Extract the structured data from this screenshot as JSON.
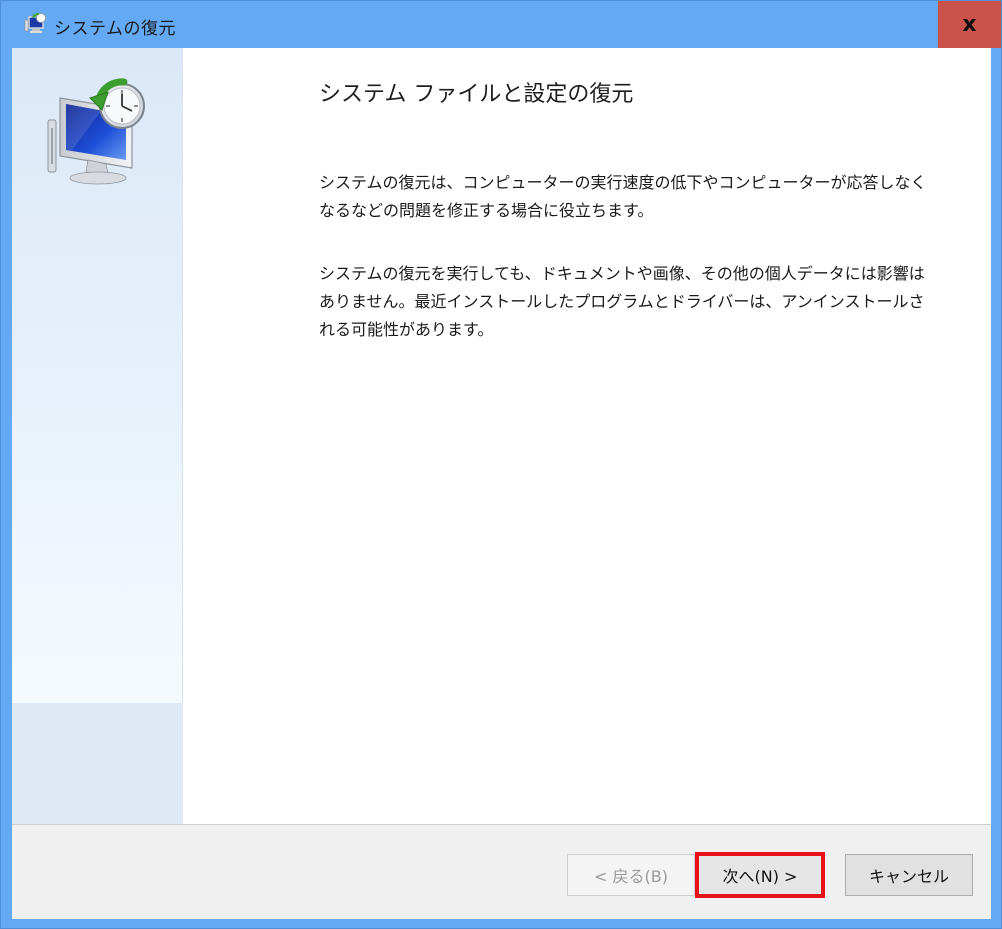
{
  "window": {
    "title": "システムの復元",
    "close_label": "x"
  },
  "content": {
    "heading": "システム ファイルと設定の復元",
    "paragraph1": "システムの復元は、コンピューターの実行速度の低下やコンピューターが応答しなくなるなどの問題を修正する場合に役立ちます。",
    "paragraph2": "システムの復元を実行しても、ドキュメントや画像、その他の個人データには影響はありません。最近インストールしたプログラムとドライバーは、アンインストールされる可能性があります。"
  },
  "buttons": {
    "back": "< 戻る(B)",
    "next": "次へ(N) >",
    "cancel": "キャンセル"
  },
  "icons": {
    "title": "system-restore-icon",
    "hero": "system-restore-monitor-clock-icon"
  },
  "colors": {
    "titlebar": "#64a9f4",
    "close": "#c9524b",
    "highlight": "#e8101a"
  }
}
